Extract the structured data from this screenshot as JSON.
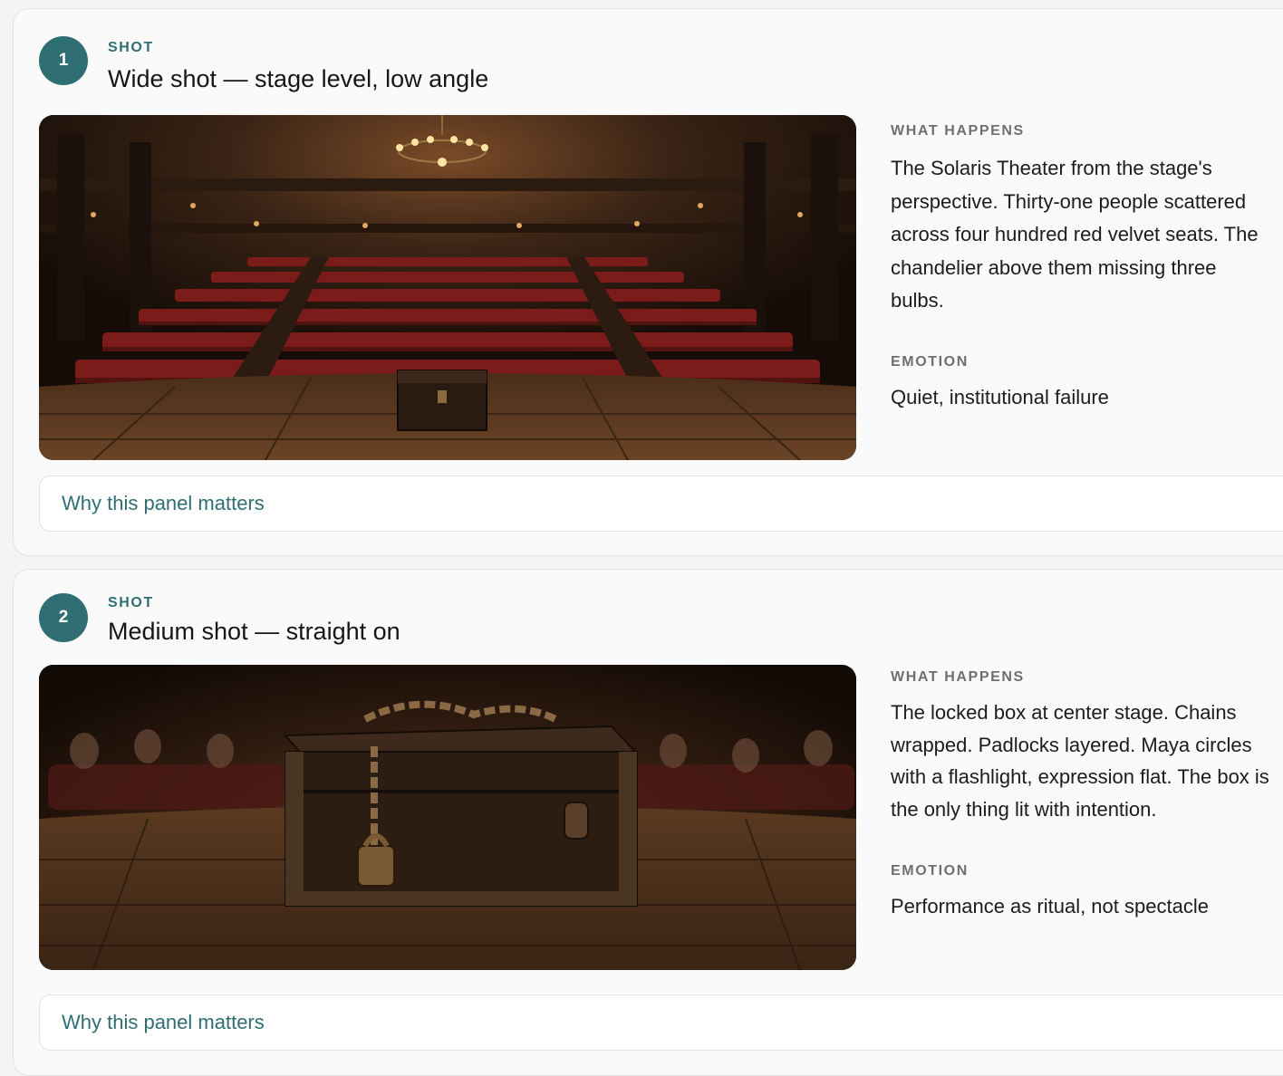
{
  "panels": [
    {
      "number": "1",
      "shot_label": "SHOT",
      "shot_title": "Wide shot — stage level, low angle",
      "image": "empty theater auditorium with red velvet seats, chandelier and locked box on stage",
      "what_happens_label": "WHAT HAPPENS",
      "what_happens": "The Solaris Theater from the stage's perspective. Thirty-one people scattered across four hundred red velvet seats. The chandelier above them missing three bulbs.",
      "emotion_label": "EMOTION",
      "emotion": "Quiet, institutional failure",
      "why_label": "Why this panel matters"
    },
    {
      "number": "2",
      "shot_label": "SHOT",
      "shot_title": "Medium shot — straight on",
      "image": "chained and padlocked wooden box on stage with blurred audience behind",
      "what_happens_label": "WHAT HAPPENS",
      "what_happens": "The locked box at center stage. Chains wrapped. Padlocks layered. Maya circles with a flashlight, expression flat. The box is the only thing lit with intention.",
      "emotion_label": "EMOTION",
      "emotion": "Performance as ritual, not spectacle",
      "why_label": "Why this panel matters"
    }
  ],
  "colors": {
    "accent": "#2f6e73",
    "card_background": "#fafafa",
    "page_background": "#f4f4f4"
  }
}
